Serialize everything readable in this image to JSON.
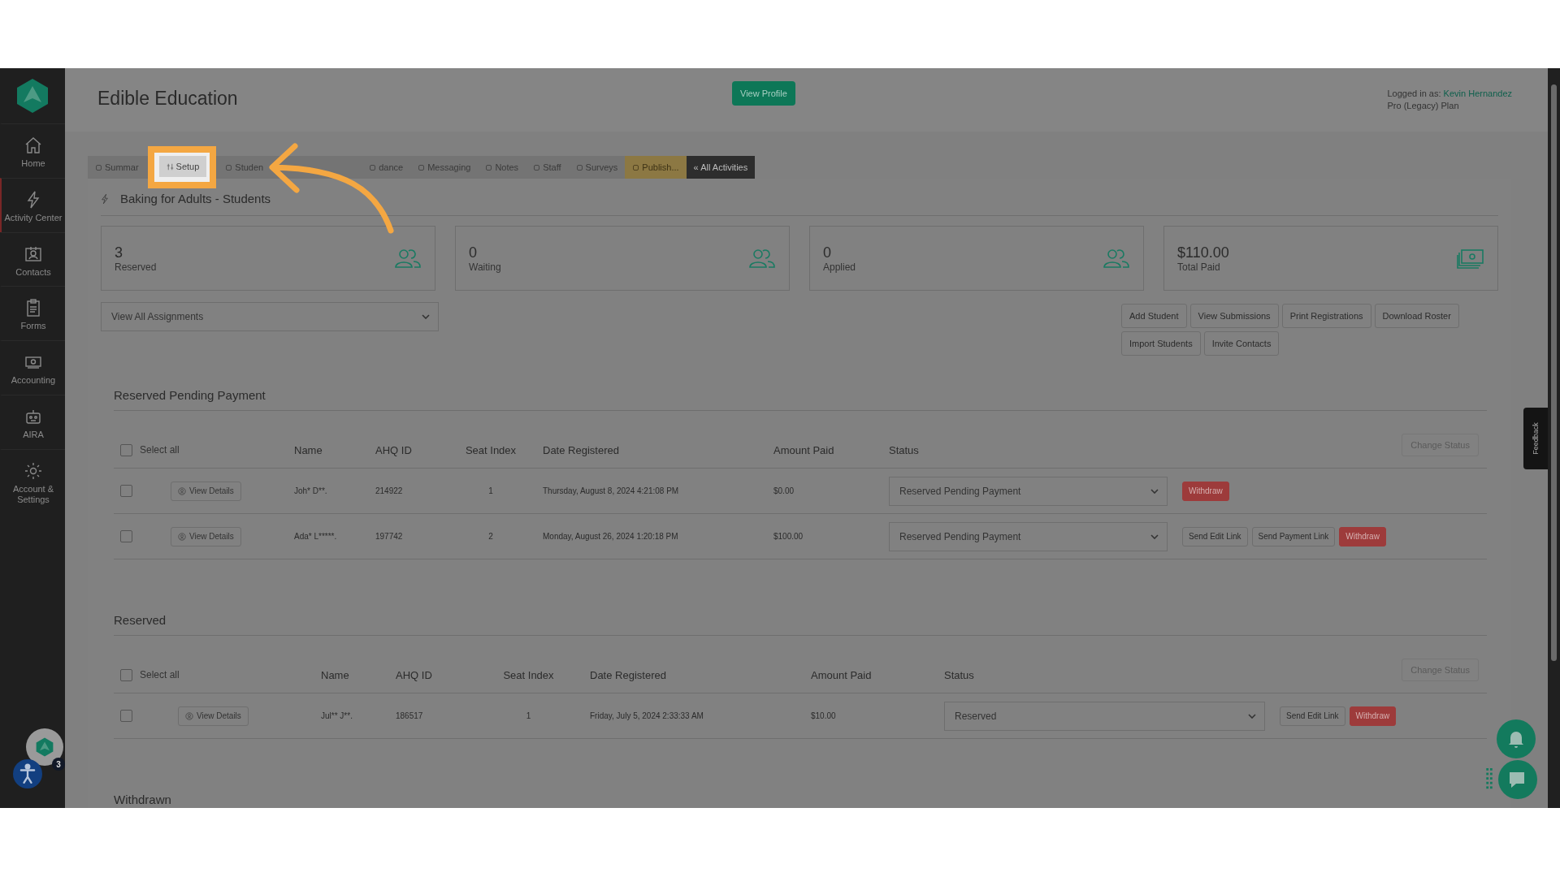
{
  "app_title": "Edible Education",
  "view_profile": "View Profile",
  "user": {
    "prefix": "Logged in as:",
    "name": "Kevin Hernandez",
    "plan": "Pro (Legacy) Plan"
  },
  "sidebar": {
    "items": [
      {
        "label": "Home",
        "selected": false
      },
      {
        "label": "Activity Center",
        "selected": true
      },
      {
        "label": "Contacts",
        "selected": false
      },
      {
        "label": "Forms",
        "selected": false
      },
      {
        "label": "Accounting",
        "selected": false
      },
      {
        "label": "AIRA",
        "selected": false
      },
      {
        "label": "Account & Settings",
        "selected": false
      }
    ]
  },
  "tabs": [
    {
      "label": "Summar",
      "kind": "normal",
      "highlighted": false
    },
    {
      "label": "Setup",
      "kind": "normal",
      "highlighted": true
    },
    {
      "label": "Studen",
      "kind": "normal",
      "highlighted": false
    },
    {
      "label": "dance",
      "kind": "normal",
      "highlighted": false
    },
    {
      "label": "Messaging",
      "kind": "normal",
      "highlighted": false
    },
    {
      "label": "Notes",
      "kind": "normal",
      "highlighted": false
    },
    {
      "label": "Staff",
      "kind": "normal",
      "highlighted": false
    },
    {
      "label": "Surveys",
      "kind": "normal",
      "highlighted": false
    },
    {
      "label": "Publish...",
      "kind": "publish",
      "highlighted": false
    },
    {
      "label": "« All Activities",
      "kind": "back",
      "highlighted": false
    }
  ],
  "page_heading": "Baking for Adults - Students",
  "stats": [
    {
      "value": "3",
      "label": "Reserved",
      "kind": "people"
    },
    {
      "value": "0",
      "label": "Waiting",
      "kind": "people"
    },
    {
      "value": "0",
      "label": "Applied",
      "kind": "people"
    },
    {
      "value": "$110.00",
      "label": "Total Paid",
      "kind": "money"
    }
  ],
  "assignment_filter": {
    "value": "View All Assignments"
  },
  "actions": [
    "Add Student",
    "View Submissions",
    "Print Registrations",
    "Download Roster",
    "Import Students",
    "Invite Contacts"
  ],
  "sections": [
    {
      "title": "Reserved Pending Payment",
      "select_all": "Select all",
      "select_all_checked": false,
      "change_status": "Change Status",
      "columns": [
        "Name",
        "AHQ ID",
        "Seat Index",
        "Date Registered",
        "Amount Paid",
        "Status"
      ],
      "rows": [
        {
          "checked": false,
          "details": "View Details",
          "name": "Joh* D**.",
          "id": "214922",
          "seat": "1",
          "date": "Thursday, August 8, 2024 4:21:08 PM",
          "amount": "$0.00",
          "status": "Reserved Pending Payment",
          "buttons": [
            {
              "label": "Withdraw",
              "kind": "danger"
            }
          ]
        },
        {
          "checked": false,
          "details": "View Details",
          "name": "Ada* L*****.",
          "id": "197742",
          "seat": "2",
          "date": "Monday, August 26, 2024 1:20:18 PM",
          "amount": "$100.00",
          "status": "Reserved Pending Payment",
          "buttons": [
            {
              "label": "Send Edit Link",
              "kind": "plain"
            },
            {
              "label": "Send Payment Link",
              "kind": "plain"
            },
            {
              "label": "Withdraw",
              "kind": "danger"
            }
          ]
        }
      ]
    },
    {
      "title": "Reserved",
      "select_all": "Select all",
      "select_all_checked": false,
      "change_status": "Change Status",
      "columns": [
        "Name",
        "AHQ ID",
        "Seat Index",
        "Date Registered",
        "Amount Paid",
        "Status"
      ],
      "rows": [
        {
          "checked": false,
          "details": "View Details",
          "name": "Jul** J**.",
          "id": "186517",
          "seat": "1",
          "date": "Friday, July 5, 2024 2:33:33 AM",
          "amount": "$10.00",
          "status": "Reserved",
          "buttons": [
            {
              "label": "Send Edit Link",
              "kind": "plain"
            },
            {
              "label": "Withdraw",
              "kind": "danger"
            }
          ]
        }
      ]
    },
    {
      "title": "Withdrawn"
    }
  ],
  "feedback": "Feedback",
  "notification_count": "3"
}
